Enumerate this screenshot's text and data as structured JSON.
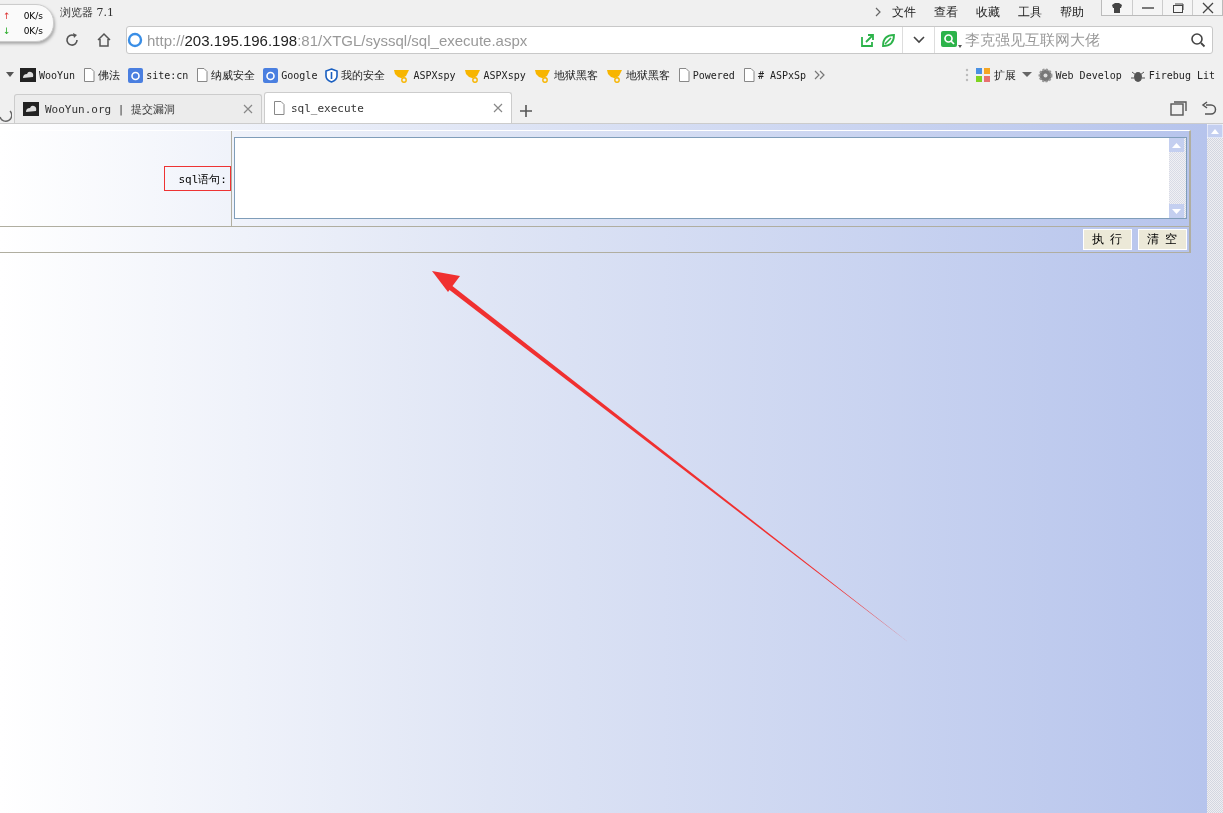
{
  "window": {
    "title": "浏览器 7.1"
  },
  "speed_widget": {
    "upload_icon": "↑",
    "upload": "0K/s",
    "download_icon": "↓",
    "download": "0K/s"
  },
  "menu": [
    "文件",
    "查看",
    "收藏",
    "工具",
    "帮助"
  ],
  "address_bar": {
    "scheme": "http://",
    "host": "203.195.196.198",
    "path": ":81/XTGL/syssql/sql_execute.aspx"
  },
  "search": {
    "placeholder": "李克强见互联网大佬"
  },
  "bookmarks": [
    {
      "label": "WooYun",
      "kind": "site"
    },
    {
      "label": "佛法",
      "kind": "page"
    },
    {
      "label": "site:cn",
      "kind": "google"
    },
    {
      "label": "纳威安全",
      "kind": "page"
    },
    {
      "label": "Google",
      "kind": "google"
    },
    {
      "label": "我的安全",
      "kind": "shield"
    },
    {
      "label": "ASPXspy",
      "kind": "trophy"
    },
    {
      "label": "ASPXspy",
      "kind": "trophy"
    },
    {
      "label": "地狱黑客",
      "kind": "trophy"
    },
    {
      "label": "地狱黑客",
      "kind": "trophy"
    },
    {
      "label": "Powered",
      "kind": "page"
    },
    {
      "label": "# ASPxSp",
      "kind": "page"
    }
  ],
  "extensions": [
    {
      "label": "扩展",
      "kind": "grid"
    },
    {
      "label": "Web Develop",
      "kind": "gear"
    },
    {
      "label": "Firebug Lit",
      "kind": "bug"
    }
  ],
  "tabs": [
    {
      "label": "WooYun.org | 提交漏洞",
      "kind": "site",
      "selected": false
    },
    {
      "label": "sql_execute",
      "kind": "page",
      "selected": true
    }
  ],
  "form": {
    "label": "sql语句:",
    "buttons": [
      "执 行",
      "清 空"
    ]
  }
}
